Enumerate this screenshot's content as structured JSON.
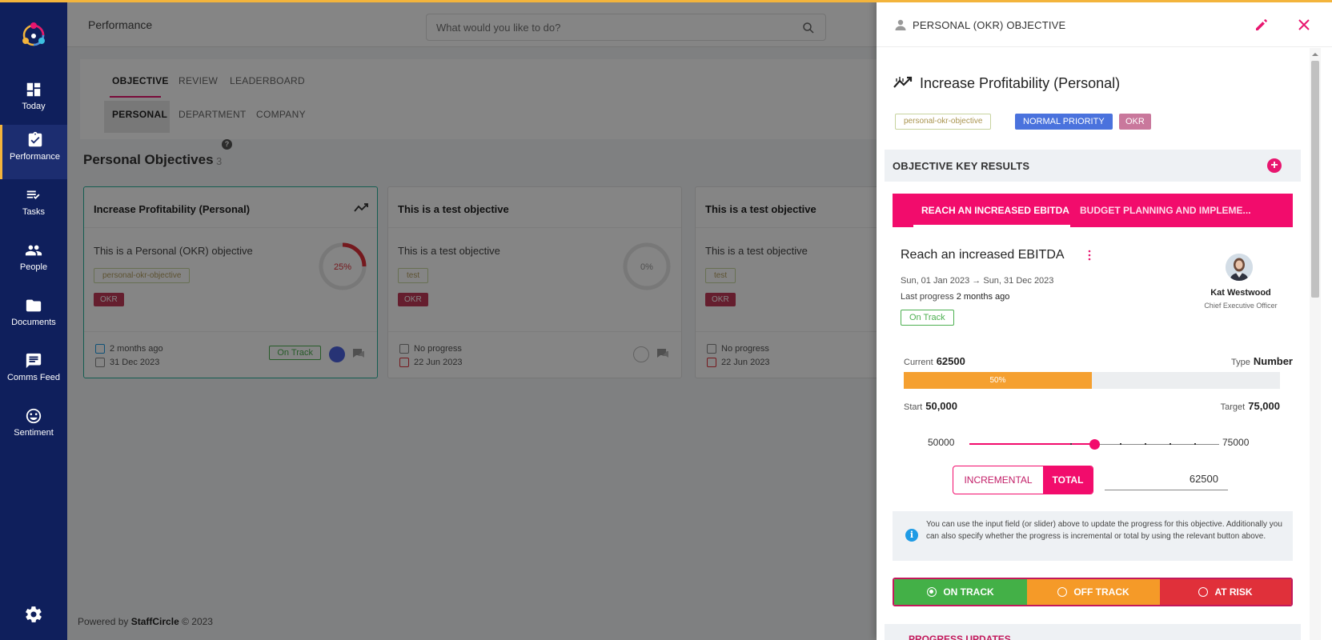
{
  "sidebar": {
    "items": [
      {
        "label": "Today",
        "icon": "dashboard-icon"
      },
      {
        "label": "Performance",
        "icon": "clipboard-check-icon"
      },
      {
        "label": "Tasks",
        "icon": "checklist-icon"
      },
      {
        "label": "People",
        "icon": "people-icon"
      },
      {
        "label": "Documents",
        "icon": "folder-icon"
      },
      {
        "label": "Comms Feed",
        "icon": "chat-icon"
      },
      {
        "label": "Sentiment",
        "icon": "smiley-icon"
      }
    ]
  },
  "header": {
    "title": "Performance",
    "search_placeholder": "What would you like to do?"
  },
  "tabs": {
    "primary": [
      "OBJECTIVE",
      "REVIEW",
      "LEADERBOARD"
    ],
    "secondary": [
      "PERSONAL",
      "DEPARTMENT",
      "COMPANY"
    ]
  },
  "section": {
    "title": "Personal Objectives",
    "count": "3"
  },
  "cards": [
    {
      "title": "Increase Profitability (Personal)",
      "description": "This is a Personal (OKR) objective",
      "tag": "personal-okr-objective",
      "type": "OKR",
      "progress_label": "25%",
      "progress": 0.25,
      "meta1": "2 months ago",
      "meta2": "31 Dec 2023",
      "status": "On Track"
    },
    {
      "title": "This is a test objective",
      "description": "This is a test objective",
      "tag": "test",
      "type": "OKR",
      "progress_label": "0%",
      "progress": 0,
      "meta1": "No progress",
      "meta2": "22 Jun 2023",
      "status": ""
    },
    {
      "title": "This is a test objective",
      "description": "This is a test objective",
      "tag": "test",
      "type": "OKR",
      "progress_label": "",
      "progress": 0,
      "meta1": "No progress",
      "meta2": "22 Jun 2023",
      "status": ""
    }
  ],
  "footer": {
    "prefix": "Powered by",
    "brand": "StaffCircle",
    "suffix": "© 2023"
  },
  "drawer": {
    "header_title": "PERSONAL (OKR) OBJECTIVE",
    "objective_title": "Increase Profitability (Personal)",
    "tags": {
      "slug": "personal-okr-objective",
      "priority": "NORMAL PRIORITY",
      "type": "OKR"
    },
    "key_results_title": "OBJECTIVE KEY RESULTS",
    "kr_tabs": [
      "REACH AN INCREASED EBITDA",
      "BUDGET PLANNING AND IMPLEME..."
    ],
    "kr": {
      "title": "Reach an increased EBITDA",
      "dates": "Sun, 01 Jan 2023 → Sun, 31 Dec 2023",
      "last_progress_label": "Last progress",
      "last_progress_value": "2 months ago",
      "status_badge": "On Track",
      "owner_name": "Kat Westwood",
      "owner_role": "Chief Executive Officer",
      "current_label": "Current",
      "current_value": "62500",
      "type_label": "Type",
      "type_value": "Number",
      "progress_label": "50%",
      "progress": 0.5,
      "start_label": "Start",
      "start_value": "50,000",
      "target_label": "Target",
      "target_value": "75,000",
      "slider_min": "50000",
      "slider_max": "75000",
      "slider_value": 62500,
      "mode_incremental": "INCREMENTAL",
      "mode_total": "TOTAL",
      "input_value": "62500",
      "info_text": "You can use the input field (or slider) above to update the progress for this objective. Additionally you can also specify whether the progress is incremental or total by using the relevant button above.",
      "status_on": "ON TRACK",
      "status_off": "OFF TRACK",
      "status_risk": "AT RISK"
    },
    "progress_updates_title": "PROGRESS UPDATES"
  },
  "colors": {
    "sidebar": "#0f1f5c",
    "accent": "#f20c6c",
    "on_track": "#43b047",
    "off_track": "#f59a28",
    "at_risk": "#e0303a",
    "progress": "#f5a030"
  }
}
